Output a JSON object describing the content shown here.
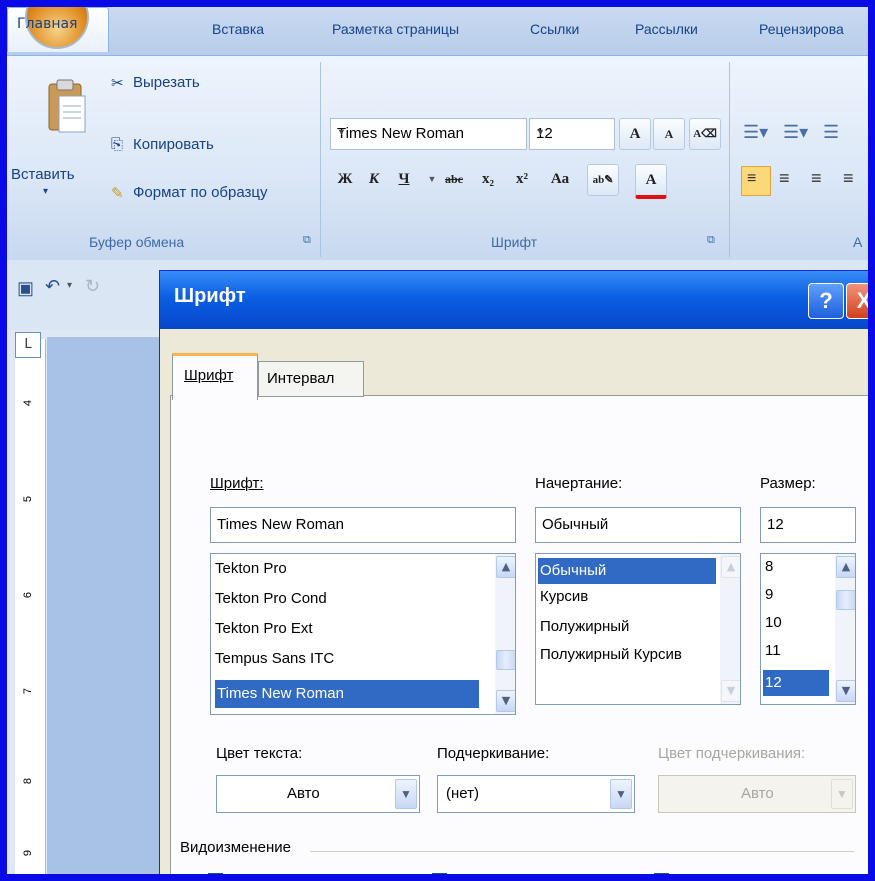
{
  "ribbon_tabs": [
    "Главная",
    "Вставка",
    "Разметка страницы",
    "Ссылки",
    "Рассылки",
    "Рецензирова"
  ],
  "clipboard": {
    "paste": "Вставить",
    "cut": "Вырезать",
    "copy": "Копировать",
    "format_painter": "Формат по образцу",
    "group": "Буфер обмена"
  },
  "font_group": {
    "font_name": "Times New Roman",
    "font_size": "12",
    "group": "Шрифт",
    "bold": "Ж",
    "italic": "К",
    "underline": "Ч",
    "strike": "abc",
    "subscript": "x₂",
    "superscript": "x²",
    "change_case": "Aa",
    "grow": "A",
    "shrink": "A"
  },
  "paragraph_group": {
    "group": "А"
  },
  "ruler_marks": [
    "4",
    "5",
    "6",
    "7",
    "8",
    "9"
  ],
  "dialog": {
    "title": "Шрифт",
    "help": "?",
    "close": "X",
    "tabs": [
      "Шрифт",
      "Интервал"
    ],
    "font_label": "Шрифт:",
    "font_value": "Times New Roman",
    "font_list": [
      "Tekton Pro",
      "Tekton Pro Cond",
      "Tekton Pro Ext",
      "Tempus Sans ITC",
      "Times New Roman"
    ],
    "style_label": "Начертание:",
    "style_value": "Обычный",
    "style_list": [
      "Обычный",
      "Курсив",
      "Полужирный",
      "Полужирный Курсив"
    ],
    "size_label": "Размер:",
    "size_value": "12",
    "size_list": [
      "8",
      "9",
      "10",
      "11",
      "12"
    ],
    "text_color_label": "Цвет текста:",
    "text_color_value": "Авто",
    "underline_label": "Подчеркивание:",
    "underline_value": "(нет)",
    "underline_color_label": "Цвет подчеркивания:",
    "underline_color_value": "Авто",
    "effects_label": "Видоизменение"
  },
  "colors": {
    "frame": "#0a0ae6",
    "title_bar": "#0a5fe3",
    "selection": "#316ac5"
  }
}
